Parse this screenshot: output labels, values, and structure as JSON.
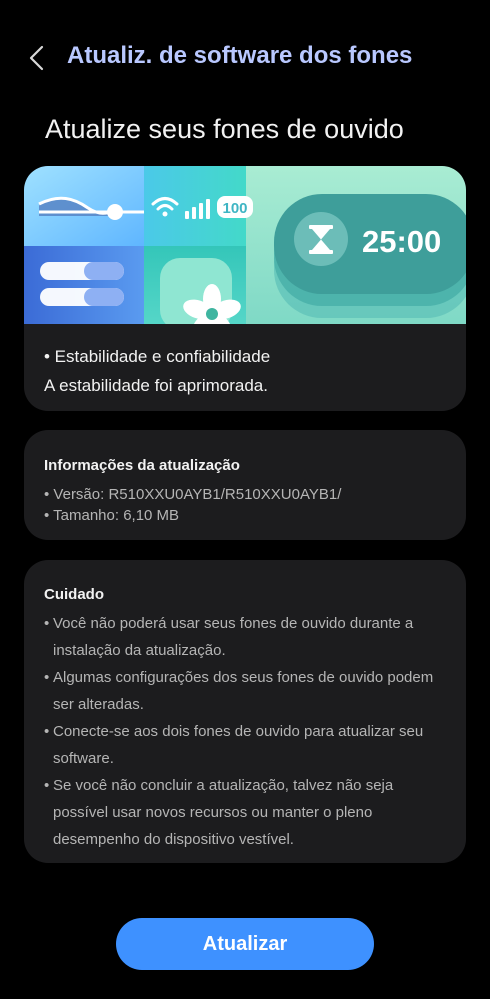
{
  "header": {
    "title": "Atualiz. de software dos fones",
    "back_icon": "chevron-left-icon"
  },
  "headline": "Atualize seus fones de ouvido",
  "banner": {
    "battery_label": "100",
    "timer_label": "25:00",
    "icons": [
      "slider-icon",
      "wifi-icon",
      "signal-bars-icon",
      "battery-icon",
      "hourglass-icon",
      "fan-icon"
    ],
    "colors": {
      "teal": "#3ed3d3",
      "blue": "#3f6fd8",
      "mint": "#9ee9c4",
      "timer_card": "#3e9e9a"
    }
  },
  "notes": {
    "line1": "• Estabilidade e confiabilidade",
    "line2": "A estabilidade foi aprimorada."
  },
  "update_info": {
    "title": "Informações da atualização",
    "version": "• Versão: R510XXU0AYB1/R510XXU0AYB1/",
    "size": "• Tamanho: 6,10 MB"
  },
  "caution": {
    "title": "Cuidado",
    "items": [
      "Você não poderá usar seus fones de ouvido durante a instalação da atualização.",
      "Algumas configurações dos seus fones de ouvido podem ser alteradas.",
      "Conecte-se aos dois fones de ouvido para atualizar seu software.",
      "Se você não concluir a atualização, talvez não seja possível usar novos recursos ou manter o pleno desempenho do dispositivo vestível."
    ]
  },
  "cta": {
    "label": "Atualizar",
    "color": "#3e91ff"
  }
}
